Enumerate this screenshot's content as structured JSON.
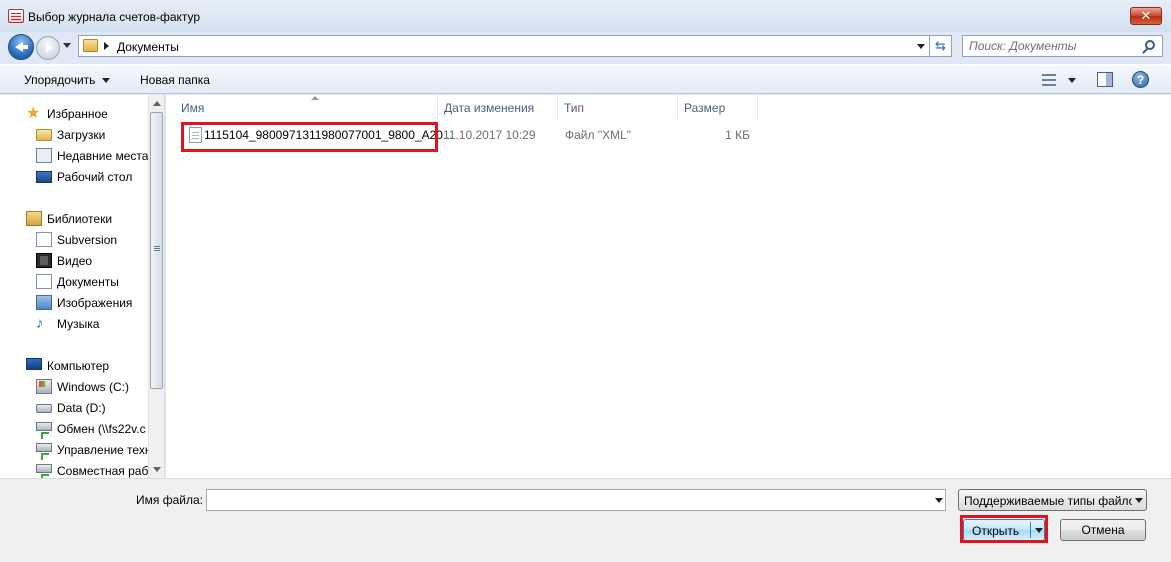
{
  "window": {
    "title": "Выбор журнала счетов-фактур",
    "close_label": "✕"
  },
  "navigation": {
    "address": "Документы",
    "search_placeholder": "Поиск: Документы"
  },
  "toolbar": {
    "organize_label": "Упорядочить",
    "new_folder_label": "Новая папка"
  },
  "sidebar": {
    "favorites": {
      "label": "Избранное",
      "items": [
        {
          "label": "Загрузки",
          "icon": "downloads-folder-icon"
        },
        {
          "label": "Недавние места",
          "icon": "recent-places-icon"
        },
        {
          "label": "Рабочий стол",
          "icon": "desktop-icon"
        }
      ]
    },
    "libraries": {
      "label": "Библиотеки",
      "items": [
        {
          "label": "Subversion",
          "icon": "subversion-icon"
        },
        {
          "label": "Видео",
          "icon": "video-icon"
        },
        {
          "label": "Документы",
          "icon": "documents-icon"
        },
        {
          "label": "Изображения",
          "icon": "images-icon"
        },
        {
          "label": "Музыка",
          "icon": "music-icon"
        }
      ]
    },
    "computer": {
      "label": "Компьютер",
      "items": [
        {
          "label": "Windows (C:)",
          "icon": "drive-c-icon"
        },
        {
          "label": "Data (D:)",
          "icon": "drive-icon"
        },
        {
          "label": "Обмен (\\\\fs22v.c",
          "icon": "network-drive-icon"
        },
        {
          "label": "Управление техн",
          "icon": "network-drive-icon"
        },
        {
          "label": "Совместная раб",
          "icon": "network-drive-icon"
        }
      ]
    }
  },
  "columns": {
    "name": "Имя",
    "date": "Дата изменения",
    "type": "Тип",
    "size": "Размер"
  },
  "files": [
    {
      "name": "1115104_9800971311980077001_9800_A20...",
      "date": "11.10.2017 10:29",
      "type": "Файл \"XML\"",
      "size": "1 КБ"
    }
  ],
  "footer": {
    "filename_label": "Имя файла:",
    "filename_value": "",
    "file_type": "Поддерживаемые типы файлов",
    "open_label": "Открыть",
    "cancel_label": "Отмена"
  },
  "colors": {
    "highlight": "#e0141e",
    "accent": "#3c7fb1"
  }
}
